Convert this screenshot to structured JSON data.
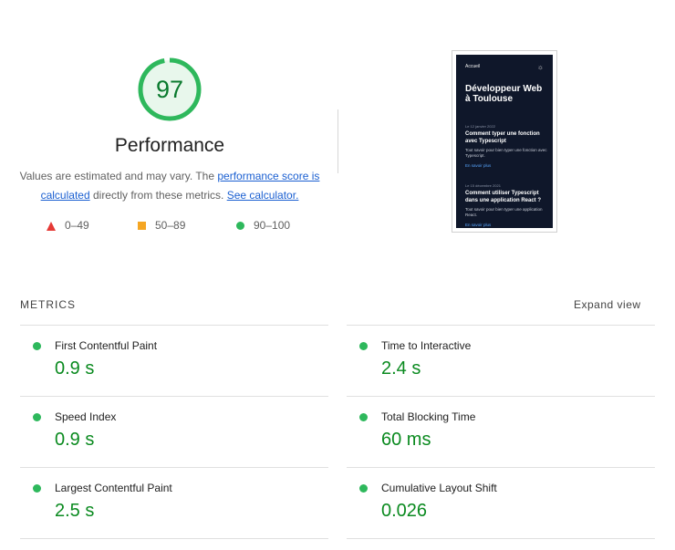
{
  "score": {
    "value": "97",
    "fraction": 0.97,
    "color": "#2eb85c"
  },
  "performance_title": "Performance",
  "description": {
    "part1": "Values are estimated and may vary. The ",
    "link1": "performance score is calculated",
    "part2": " directly from these metrics. ",
    "link2": "See calculator."
  },
  "legend": [
    {
      "icon": "triangle-icon",
      "label": "0–49",
      "color": "#e53935"
    },
    {
      "icon": "square-icon",
      "label": "50–89",
      "color": "#f5a623"
    },
    {
      "icon": "circle-icon",
      "label": "90–100",
      "color": "#2eb85c"
    }
  ],
  "screenshot": {
    "nav": "Accueil",
    "headline": "Développeur Web à Toulouse",
    "posts": [
      {
        "date": "Le 12 janvier 2022",
        "title": "Comment typer une fonction avec Typescript",
        "desc": "Tout savoir pour bien typer une fonction avec Typescript.",
        "more": "En savoir plus"
      },
      {
        "date": "Le 15 décembre 2021",
        "title": "Comment utiliser Typescript dans une application React ?",
        "desc": "Tout savoir pour bien typer une application React.",
        "more": "En savoir plus"
      }
    ]
  },
  "metrics": {
    "label": "METRICS",
    "expand": "Expand view",
    "items": [
      {
        "name": "First Contentful Paint",
        "value": "0.9 s"
      },
      {
        "name": "Time to Interactive",
        "value": "2.4 s"
      },
      {
        "name": "Speed Index",
        "value": "0.9 s"
      },
      {
        "name": "Total Blocking Time",
        "value": "60 ms"
      },
      {
        "name": "Largest Contentful Paint",
        "value": "2.5 s"
      },
      {
        "name": "Cumulative Layout Shift",
        "value": "0.026"
      }
    ]
  }
}
